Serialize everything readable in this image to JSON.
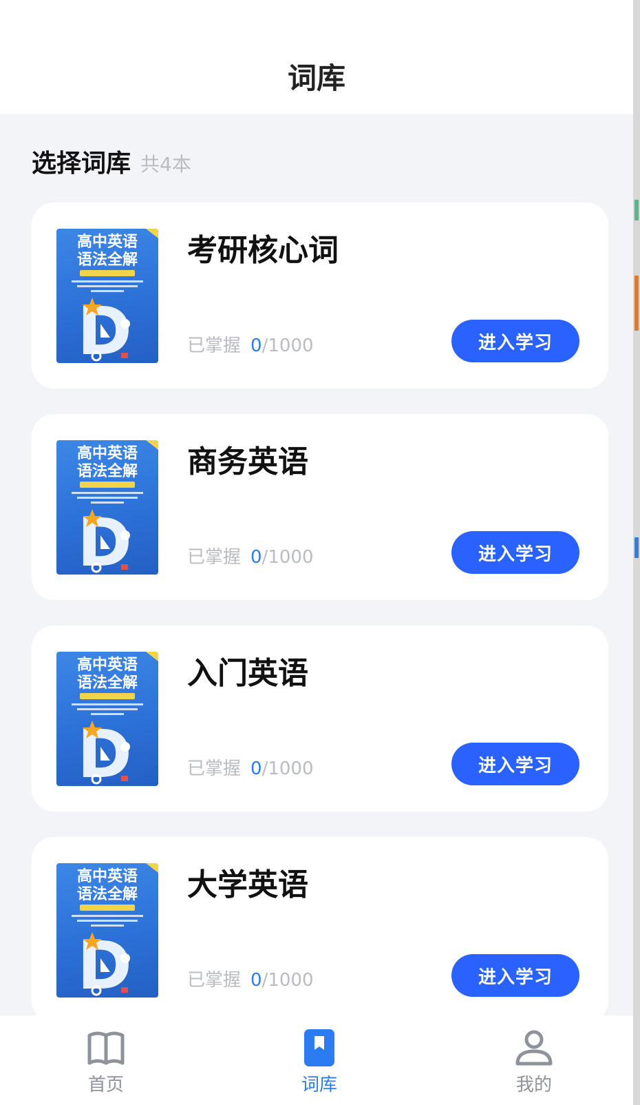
{
  "header": {
    "title": "词库"
  },
  "section": {
    "title": "选择词库",
    "count": "共4本"
  },
  "books": [
    {
      "name": "考研核心词",
      "progress_label": "已掌握",
      "mastered": "0",
      "total": "/1000",
      "button": "进入学习",
      "cover": {
        "title_line1": "高中英语",
        "title_line2": "语法全解",
        "letter": "D"
      }
    },
    {
      "name": "商务英语",
      "progress_label": "已掌握",
      "mastered": "0",
      "total": "/1000",
      "button": "进入学习",
      "cover": {
        "title_line1": "高中英语",
        "title_line2": "语法全解",
        "letter": "D"
      }
    },
    {
      "name": "入门英语",
      "progress_label": "已掌握",
      "mastered": "0",
      "total": "/1000",
      "button": "进入学习",
      "cover": {
        "title_line1": "高中英语",
        "title_line2": "语法全解",
        "letter": "D"
      }
    },
    {
      "name": "大学英语",
      "progress_label": "已掌握",
      "mastered": "0",
      "total": "/1000",
      "button": "进入学习",
      "cover": {
        "title_line1": "高中英语",
        "title_line2": "语法全解",
        "letter": "D"
      }
    }
  ],
  "tabbar": {
    "items": [
      {
        "label": "首页",
        "icon": "book-open-icon",
        "active": false
      },
      {
        "label": "词库",
        "icon": "bookmark-icon",
        "active": true
      },
      {
        "label": "我的",
        "icon": "user-icon",
        "active": false
      }
    ],
    "active_color": "#2b7cf0",
    "inactive_color": "#8e929b"
  },
  "colors": {
    "accent": "#2962ff",
    "page_bg": "#f3f4f7",
    "mastered": "#2b7cf0"
  }
}
